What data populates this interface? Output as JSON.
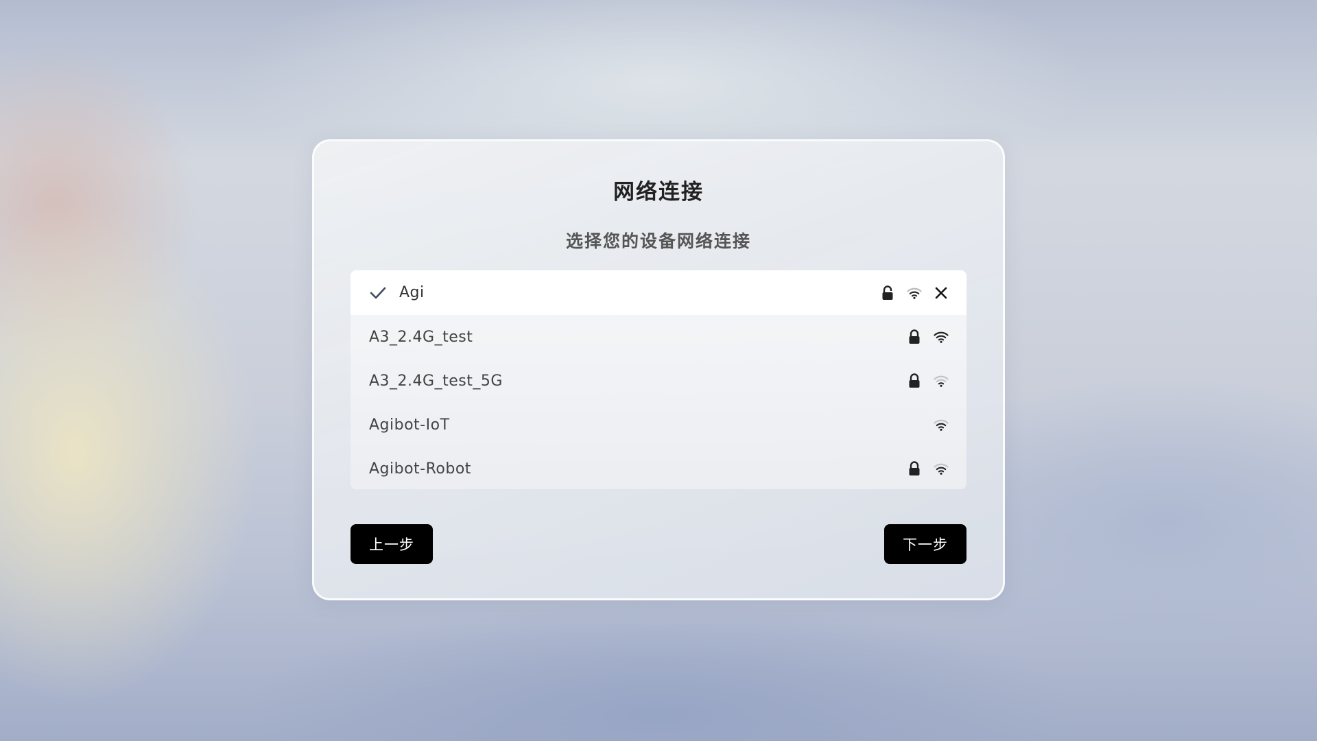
{
  "dialog": {
    "title": "网络连接",
    "subtitle": "选择您的设备网络连接"
  },
  "networks": [
    {
      "name": "Agi",
      "selected": true,
      "locked": true,
      "signal": "medium",
      "icons": [
        "lock-icon",
        "wifi-icon",
        "close-icon"
      ]
    },
    {
      "name": "A3_2.4G_test",
      "selected": false,
      "locked": true,
      "signal": "strong",
      "icons": [
        "lock-icon",
        "wifi-icon"
      ]
    },
    {
      "name": "A3_2.4G_test_5G",
      "selected": false,
      "locked": true,
      "signal": "weak",
      "icons": [
        "lock-icon",
        "wifi-icon"
      ]
    },
    {
      "name": "Agibot-IoT",
      "selected": false,
      "locked": false,
      "signal": "medium",
      "icons": [
        "wifi-icon"
      ]
    },
    {
      "name": "Agibot-Robot",
      "selected": false,
      "locked": true,
      "signal": "medium",
      "icons": [
        "lock-icon",
        "wifi-icon"
      ]
    }
  ],
  "buttons": {
    "prev_label": "上一步",
    "next_label": "下一步"
  },
  "colors": {
    "button_bg": "#000000",
    "button_text": "#ffffff",
    "selected_row_bg": "#ffffff",
    "check_color": "#3d4a5c"
  }
}
